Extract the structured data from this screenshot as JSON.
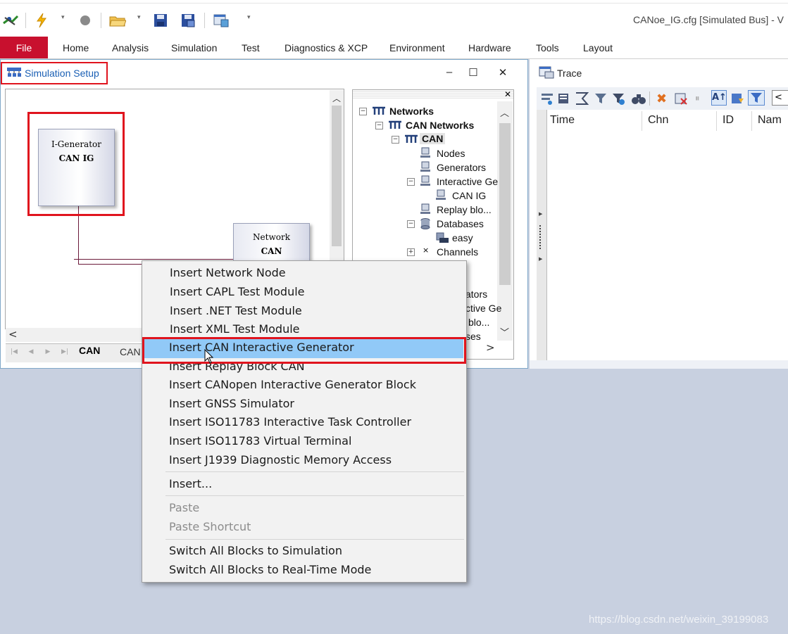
{
  "window": {
    "title": "CANoe_IG.cfg [Simulated Bus] - V"
  },
  "quick_access": {
    "icons": [
      "network-sim-icon",
      "lightning-icon",
      "dropdown-arrow",
      "record-circle-icon",
      "open-folder-icon",
      "dropdown-arrow",
      "save-icon",
      "save-as-icon",
      "config-icon",
      "customize-arrow"
    ]
  },
  "ribbon": {
    "file_label": "File",
    "tabs": [
      "Home",
      "Analysis",
      "Simulation",
      "Test",
      "Diagnostics & XCP",
      "Environment",
      "Hardware",
      "Tools",
      "Layout"
    ]
  },
  "sim_setup": {
    "title": "Simulation Setup",
    "blocks": {
      "ig": {
        "line1": "I-Generator",
        "line2": "CAN IG"
      },
      "network": {
        "line1": "Network",
        "line2": "CAN"
      }
    },
    "sheet_tabs": [
      "CAN",
      "CAN"
    ],
    "tree": [
      {
        "label": "Networks",
        "bold": true
      },
      {
        "label": "CAN Networks",
        "bold": true
      },
      {
        "label": "CAN",
        "bold": true
      },
      {
        "label": "Nodes"
      },
      {
        "label": "Generators"
      },
      {
        "label": "Interactive Ge"
      },
      {
        "label": "CAN IG"
      },
      {
        "label": "Replay blo..."
      },
      {
        "label": "Databases"
      },
      {
        "label": "easy"
      },
      {
        "label": "Channels"
      },
      {
        "label": "ators"
      },
      {
        "label": "ctive Ge"
      },
      {
        "label": "blo..."
      },
      {
        "label": "ses"
      }
    ]
  },
  "trace": {
    "title": "Trace",
    "columns": [
      "Time",
      "Chn",
      "ID",
      "Nam"
    ]
  },
  "context_menu": {
    "items": [
      "Insert Network Node",
      "Insert CAPL Test Module",
      "Insert .NET Test Module",
      "Insert XML Test Module",
      "Insert CAN Interactive Generator",
      "Insert Replay Block CAN",
      "Insert CANopen Interactive Generator Block",
      "Insert GNSS Simulator",
      "Insert ISO11783 Interactive Task Controller",
      "Insert ISO11783 Virtual Terminal",
      "Insert J1939 Diagnostic Memory Access",
      "Insert...",
      "Paste",
      "Paste Shortcut",
      "Switch All Blocks to Simulation",
      "Switch All Blocks to Real-Time Mode"
    ],
    "highlighted": "Insert CAN Interactive Generator"
  },
  "watermark": "https://blog.csdn.net/weixin_39199083",
  "colors": {
    "file_tab": "#c8102e",
    "highlight": "#91c9f7",
    "annotation_red": "#e0141e",
    "desktop": "#c8d0e0"
  }
}
